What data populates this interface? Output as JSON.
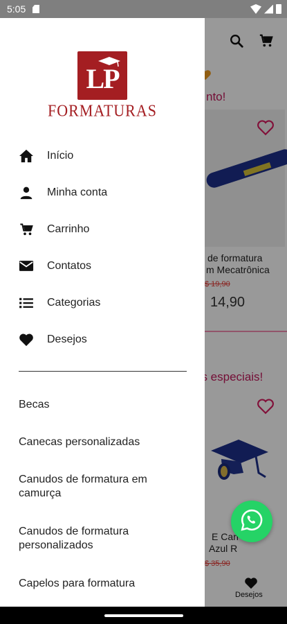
{
  "status_bar": {
    "time": "5:05"
  },
  "background": {
    "promo_text_1": "nto!",
    "promo_text_2": "os especiais!",
    "product_1": {
      "title_line1": "de formatura",
      "title_line2": "m Mecatrônica",
      "old_price": "$ 19,90",
      "price": "14,90"
    },
    "product_2": {
      "title_line1": "E Can",
      "title_line2": "Azul R",
      "old_price": "$ 35,90"
    },
    "bottom_nav_label": "Desejos"
  },
  "drawer": {
    "logo": {
      "mark": "LP",
      "text": "FORMATURAS"
    },
    "menu": [
      {
        "label": "Início",
        "icon": "home-icon"
      },
      {
        "label": "Minha conta",
        "icon": "person-icon"
      },
      {
        "label": "Carrinho",
        "icon": "cart-icon"
      },
      {
        "label": "Contatos",
        "icon": "mail-icon"
      },
      {
        "label": "Categorias",
        "icon": "list-icon"
      },
      {
        "label": "Desejos",
        "icon": "heart-icon"
      }
    ],
    "categories": [
      "Becas",
      "Canecas personalizadas",
      "Canudos de formatura em camurça",
      "Canudos de formatura personalizados",
      "Capelos para formatura"
    ]
  },
  "colors": {
    "brand": "#a41e22",
    "accent": "#e91e63",
    "whatsapp": "#25d366"
  }
}
